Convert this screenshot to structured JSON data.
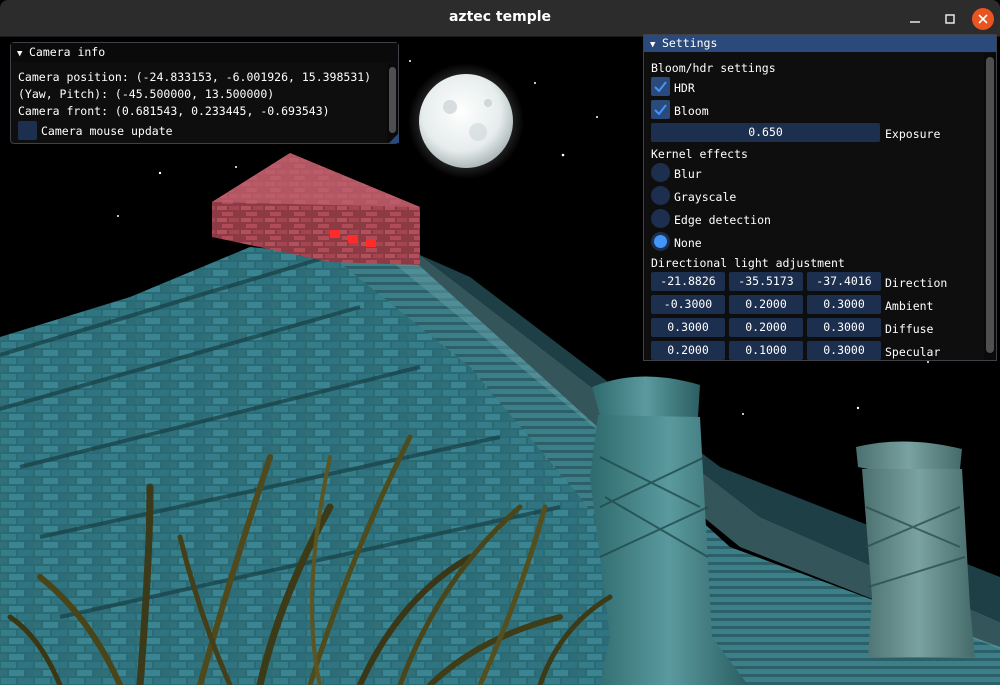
{
  "window": {
    "title": "aztec temple",
    "minimize_icon": "minimize-icon",
    "maximize_icon": "maximize-icon",
    "close_icon": "close-icon"
  },
  "camera_panel": {
    "title": "Camera info",
    "position_line": "Camera position: (-24.833153, -6.001926, 15.398531)",
    "yaw_pitch_line": "(Yaw, Pitch): (-45.500000, 13.500000)",
    "front_line": "Camera front: (0.681543, 0.233445, -0.693543)",
    "mouse_update": {
      "label": "Camera mouse update",
      "checked": false
    }
  },
  "settings_panel": {
    "title": "Settings",
    "bloom_header": "Bloom/hdr settings",
    "hdr": {
      "label": "HDR",
      "checked": true
    },
    "bloom": {
      "label": "Bloom",
      "checked": true
    },
    "exposure": {
      "value": "0.650",
      "label": "Exposure"
    },
    "kernel_header": "Kernel effects",
    "kernel_options": [
      {
        "label": "Blur",
        "selected": false
      },
      {
        "label": "Grayscale",
        "selected": false
      },
      {
        "label": "Edge detection",
        "selected": false
      },
      {
        "label": "None",
        "selected": true
      }
    ],
    "light_header": "Directional light adjustment",
    "light_rows": [
      {
        "values": [
          "-21.8826",
          "-35.5173",
          "-37.4016"
        ],
        "label": "Direction"
      },
      {
        "values": [
          "-0.3000",
          "0.2000",
          "0.3000"
        ],
        "label": "Ambient"
      },
      {
        "values": [
          "0.3000",
          "0.2000",
          "0.3000"
        ],
        "label": "Diffuse"
      },
      {
        "values": [
          "0.2000",
          "0.1000",
          "0.3000"
        ],
        "label": "Specular"
      }
    ]
  },
  "colors": {
    "titlebar": "#2c2c2c",
    "close_button": "#e95420",
    "panel_bg": "#0f0f0f",
    "widget_bg": "#1d2f4e",
    "accent": "#4296fa",
    "header_active": "#294a7a",
    "temple_stone": "#2f6f7a",
    "temple_top": "#b04a58"
  }
}
